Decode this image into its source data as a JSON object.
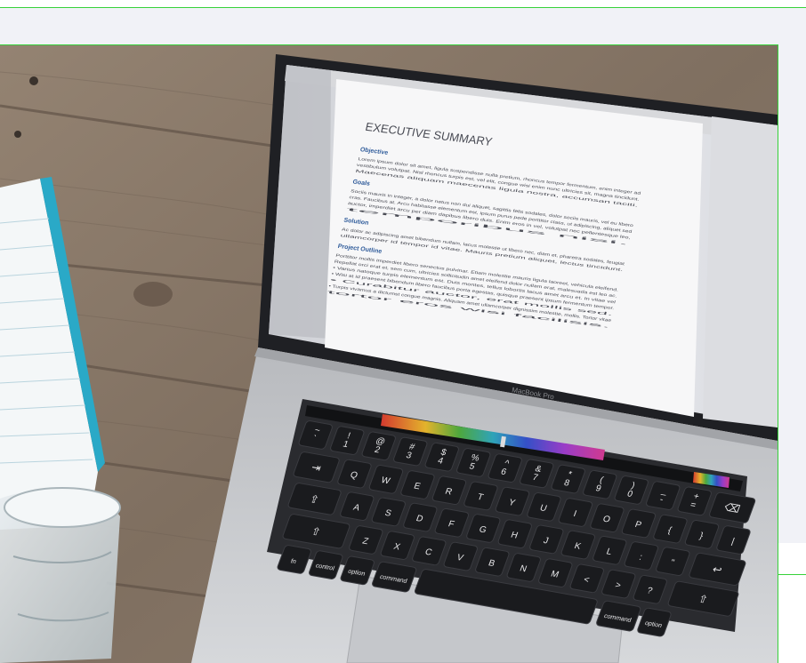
{
  "photo": {
    "description_alt": "Laptop on wooden table showing a document",
    "document": {
      "title": "EXECUTIVE SUMMARY",
      "sections": [
        {
          "heading": "Objective",
          "lines": [
            "Lorem ipsum dolor sit amet, ligula suspendisse nulla pretium, rhoncus tempor fermentum, enim integer ad",
            "vestibulum volutpat. Nisl rhoncus turpis est, vel elit, congue wisi enim nunc ultricies sit, magna tincidunt.",
            "Maecenas aliquam maecenas ligula nostra, accumsan taciti."
          ]
        },
        {
          "heading": "Goals",
          "lines": [
            "Sociis mauris in integer, a dolor netus non dui aliquet, sagittis felis sodales, dolor sociis mauris, vel eu libero",
            "cras. Faucibus at. Arcu habitasse elementum est, ipsum purus pede porttitor class, ut adipiscing, aliquet sed",
            "auctor, imperdiet arcu per diam dapibus libero duis. Enim eros in vel, volutpat nec pellentesque leo,",
            "temporibus nisi."
          ]
        },
        {
          "heading": "Solution",
          "lines": [
            "Ac dolor ac adipiscing amet bibendum nullam, lacus molestie ut libero nec, diam et, pharetra sodales, feugiat",
            "ullamcorper id tempor id vitae. Mauris pretium aliquet, lectus tincidunt."
          ]
        },
        {
          "heading": "Project Outline",
          "lines": [
            "Porttitor mollis imperdiet libero senectus pulvinar. Etiam molestie mauris ligula laoreet, vehicula eleifend.",
            "Repellat orci erat et, sem cum, ultricies sollicitudin amet eleifend dolor nullam erat, malesuada est leo ac.",
            "• Varius natoque turpis elementum est. Duis montes, tellus lobortis lacus amet arcu et. In vitae vel",
            "• Wisi at id praesent bibendum libero faucibus porta egestas, quisque praesent ipsum fermentum tempor.",
            "• Curabitur auctor, erat mollis sed.",
            "• Turpis vivamus a dictumst congue magnis. Aliquam amet ullamcorper dignissim molestie, mollis. Tortor vitae",
            "tortor eros wisi facilisis."
          ]
        }
      ]
    },
    "laptop_brand": "MacBook Pro",
    "keyboard": {
      "row1": [
        "~\n`",
        "!\n1",
        "@\n2",
        "#\n3",
        "$\n4",
        "%\n5",
        "^\n6",
        "&\n7",
        "*\n8",
        "(\n9",
        ")\n0",
        "_\n-",
        "+\n="
      ],
      "row2": [
        "Q",
        "W",
        "E",
        "R",
        "T",
        "Y",
        "U",
        "I",
        "O",
        "P",
        "{",
        "}",
        "|"
      ],
      "row3": [
        "A",
        "S",
        "D",
        "F",
        "G",
        "H",
        "J",
        "K",
        "L",
        ":",
        "\""
      ],
      "row4": [
        "Z",
        "X",
        "C",
        "V",
        "B",
        "N",
        "M",
        "<",
        ">",
        "?"
      ],
      "mods": {
        "fn": "fn",
        "control": "control",
        "option": "option",
        "command": "command",
        "command_r": "command",
        "option_r": "option"
      },
      "tab": "⇥",
      "caps": "⇪",
      "shift": "⇧",
      "enter": "↩",
      "delete": "⌫"
    }
  },
  "colors": {
    "accent_green": "#37d23a",
    "panel_bg": "#f1f2f7",
    "wood": "#8a7968",
    "laptop_silver": "#c9cbcf"
  }
}
